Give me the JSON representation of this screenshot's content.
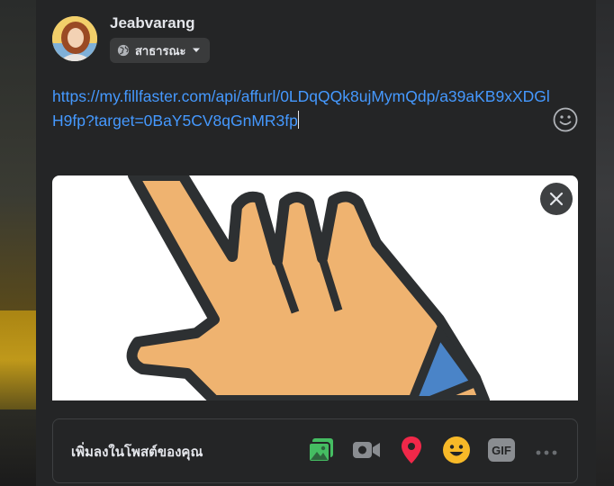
{
  "composer": {
    "author_name": "Jeabvarang",
    "audience_label": "สาธารณะ",
    "post_text": "https://my.fillfaster.com/api/affurl/0LDqQQk8ujMymQdp/a39aKB9xXDGlH9fp?target=0BaY5CV8qGnMR3fp"
  },
  "add_to_post": {
    "label": "เพิ่มลงในโพสต์ของคุณ",
    "gif_label": "GIF"
  },
  "icons": {
    "audience": "globe-icon",
    "emoji": "smiley-icon",
    "close": "close-icon",
    "photo": "photo-video-icon",
    "video": "video-camera-icon",
    "location": "location-pin-icon",
    "feeling": "feeling-emoji-icon",
    "gif": "gif-icon",
    "more": "more-dots-icon"
  },
  "colors": {
    "link": "#4599ff",
    "photo": "#45bd62",
    "location": "#f02849",
    "feeling": "#f7b928"
  }
}
